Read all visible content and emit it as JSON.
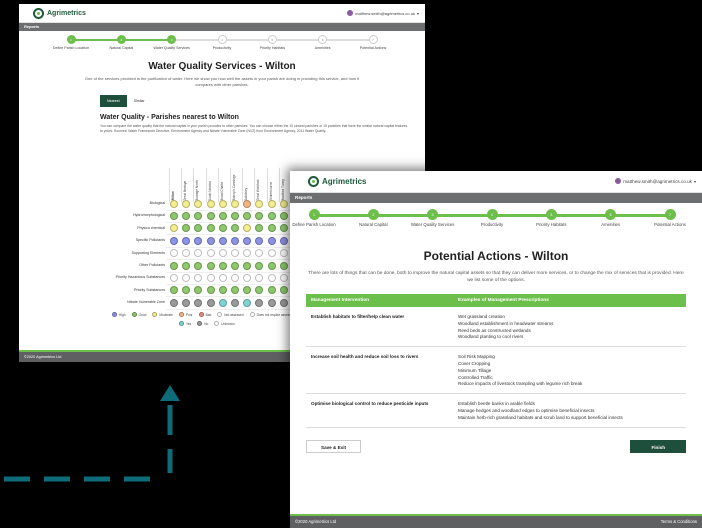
{
  "brand": {
    "name": "Agrimetrics",
    "primary": "#1e4e3c",
    "accent": "#6cbf4a",
    "arrow_color": "#0e6b7a"
  },
  "user": {
    "email": "matthew.smith@agrimetrics.co.uk",
    "caret": "▾"
  },
  "nav": {
    "reports": "Reports"
  },
  "steps": [
    {
      "label": "Define Parish Location",
      "num": "1"
    },
    {
      "label": "Natural Capital",
      "num": "2"
    },
    {
      "label": "Water Quality Services",
      "num": "3"
    },
    {
      "label": "Productivity",
      "num": "4"
    },
    {
      "label": "Priority Habitats",
      "num": "5"
    },
    {
      "label": "Amenities",
      "num": "6"
    },
    {
      "label": "Potential Actions",
      "num": "7"
    }
  ],
  "water": {
    "title": "Water Quality Services - Wilton",
    "intro": "One of the services provided is the purification of water. Here we show you how well the assets in your parish are doing in providing this service, and how it compares with other parishes.",
    "tabs": [
      "Nearest",
      "Similar"
    ],
    "section_title": "Water Quality - Parishes nearest to Wilton",
    "section_desc": "You can compare the water quality that the natural capital in your parish provides to other parishes. You can choose either the 10 closest parishes or 10 parishes that have the similar natural capital features to yours. Sources: Water Framework Directive, Environment Agency and Nitrate Vulnerable Zone (NVZ) from Environment Agency, 2011 Water Quality.",
    "columns": [
      "Wilton",
      "Great Bedwyn",
      "Burbage North",
      "South Newton",
      "Broad Chalke",
      "Bishop's Cannings",
      "Salisbury",
      "Great Wishford",
      "Winterbourne",
      "Bradford Tuney"
    ],
    "rows": [
      "Biological",
      "Hydromorphological",
      "Physico chemical",
      "Specific Pollutants",
      "Supporting Elements",
      "Other Pollutants",
      "Priority Hazardous Substances",
      "Priority Substances",
      "Nitrate Vulnerable Zone"
    ],
    "row_cells": [
      [
        "#f4ee8e",
        "#f4ee8e",
        "#f4ee8e",
        "#f4ee8e",
        "#f4ee8e",
        "#f4ee8e",
        "#f4b482",
        "#f4ee8e",
        "#f4ee8e",
        "#f4ee8e"
      ],
      [
        "#8dc86b",
        "#8dc86b",
        "#8dc86b",
        "#8dc86b",
        "#8dc86b",
        "#8dc86b",
        "#8dc86b",
        "#8dc86b",
        "#8dc86b",
        "#8dc86b"
      ],
      [
        "#f4ee8e",
        "#8dc86b",
        "#8dc86b",
        "#8dc86b",
        "#8dc86b",
        "#8dc86b",
        "#f4ee8e",
        "#8dc86b",
        "#8dc86b",
        "#8dc86b"
      ],
      [
        "#8c92e6",
        "#8c92e6",
        "#8c92e6",
        "#8c92e6",
        "#8c92e6",
        "#8c92e6",
        "#8c92e6",
        "#8c92e6",
        "#8c92e6",
        "#8c92e6"
      ],
      [
        "#ffffff",
        "#ffffff",
        "#ffffff",
        "#ffffff",
        "#ffffff",
        "#ffffff",
        "#ffffff",
        "#ffffff",
        "#ffffff",
        "#ffffff"
      ],
      [
        "#8dc86b",
        "#8dc86b",
        "#8dc86b",
        "#8dc86b",
        "#8dc86b",
        "#8dc86b",
        "#8dc86b",
        "#8dc86b",
        "#8dc86b",
        "#8dc86b"
      ],
      [
        "#ffffff",
        "#ffffff",
        "#ffffff",
        "#ffffff",
        "#ffffff",
        "#ffffff",
        "#ffffff",
        "#ffffff",
        "#ffffff",
        "#ffffff"
      ],
      [
        "#8dc86b",
        "#8dc86b",
        "#8dc86b",
        "#8dc86b",
        "#8dc86b",
        "#8dc86b",
        "#8dc86b",
        "#8dc86b",
        "#8dc86b",
        "#8dc86b"
      ],
      [
        "#9a9a9a",
        "#9a9a9a",
        "#9a9a9a",
        "#9a9a9a",
        "#7fd3d3",
        "#9a9a9a",
        "#7fd3d3",
        "#9a9a9a",
        "#9a9a9a",
        "#9a9a9a"
      ]
    ],
    "legend1": [
      {
        "label": "High",
        "color": "#8c92e6"
      },
      {
        "label": "Good",
        "color": "#8dc86b"
      },
      {
        "label": "Moderate",
        "color": "#f4ee8e"
      },
      {
        "label": "Poor",
        "color": "#f4b482"
      },
      {
        "label": "Bad",
        "color": "#e88a8a"
      },
      {
        "label": "Not assessed",
        "color": "#ffffff"
      },
      {
        "label": "Does not require assessment",
        "color": "#ffffff"
      }
    ],
    "legend2": [
      {
        "label": "Yes",
        "color": "#7fd3d3"
      },
      {
        "label": "No",
        "color": "#9a9a9a"
      },
      {
        "label": "Unknown",
        "color": "#ffffff"
      }
    ],
    "footer": "©2020 Agrimetrics Ltd"
  },
  "actions": {
    "title": "Potential Actions - Wilton",
    "intro": "There are lots of things that can be done, both to improve the natural capital assets so that they can deliver more services, or to change the mix of services that is provided. Here we list some of the options.",
    "col1": "Management Intervention",
    "col2": "Examples of Management Prescriptions",
    "rows": [
      {
        "intervention": "Establish habitats to filter/help clean water",
        "examples": [
          "Wet grassland creation",
          "Woodland establishment in headwater streams",
          "Reed beds as constructed wetlands",
          "Woodland planting to cool rivers"
        ]
      },
      {
        "intervention": "Increase soil health and reduce soil loss to rivers",
        "examples": [
          "Soil Risk Mapping",
          "Cover Cropping",
          "Minimum Tillage",
          "Controlled Traffic",
          "Reduce impacts of livestock trampling with legume rich break"
        ]
      },
      {
        "intervention": "Optimise biological control to reduce pesticide inputs",
        "examples": [
          "Establish beetle banks in arable fields",
          "Manage hedges and woodland edges to optimise beneficial insects",
          "Maintain herb-rich grassland habitats and scrub land to support beneficial insects"
        ]
      }
    ],
    "save_label": "Save & Exit",
    "finish_label": "Finish",
    "footer": "©2020 Agrimetrics Ltd",
    "terms": "Terms & Conditions"
  }
}
